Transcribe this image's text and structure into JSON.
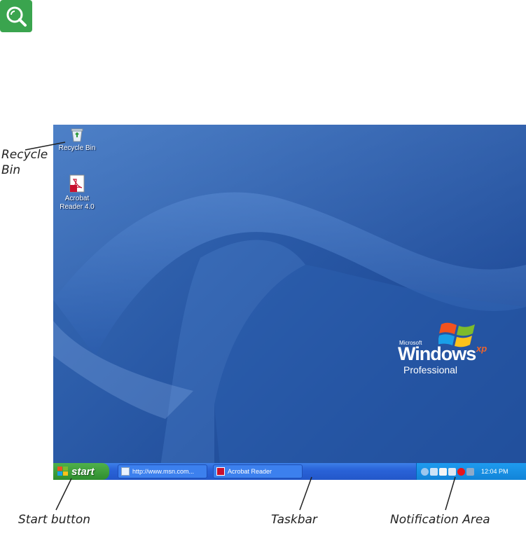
{
  "desktop": {
    "icons": [
      {
        "label": "Recycle Bin",
        "icon": "recycle-bin-icon"
      },
      {
        "label": "Acrobat Reader 4.0",
        "icon": "acrobat-reader-icon"
      }
    ],
    "logo": {
      "microsoft": "Microsoft",
      "windows": "Windows",
      "xp": "xp",
      "edition": "Professional"
    }
  },
  "taskbar": {
    "start_label": "start",
    "buttons": [
      {
        "label": "http://www.msn.com...",
        "icon": "internet-explorer-icon"
      },
      {
        "label": "Acrobat Reader",
        "icon": "acrobat-reader-icon"
      }
    ],
    "tray": {
      "clock": "12:04 PM"
    }
  },
  "callouts": {
    "recycle_bin": "Recycle Bin",
    "start_button": "Start button",
    "taskbar": "Taskbar",
    "notification_area": "Notification Area"
  },
  "colors": {
    "desktop_blue": "#2a5aa7",
    "taskbar_blue": "#2a63d8",
    "start_green": "#3a9e3a",
    "tray_blue": "#1284d8"
  }
}
